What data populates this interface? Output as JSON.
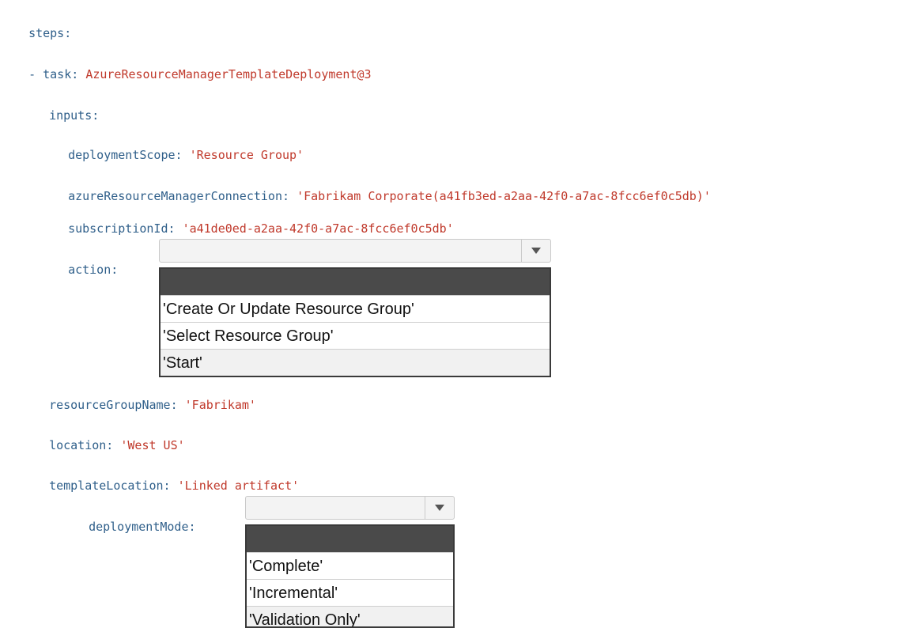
{
  "yaml": {
    "steps": "steps:",
    "task_dash": "- ",
    "task_key": "task:",
    "task_val": "AzureResourceManagerTemplateDeployment@3",
    "inputs": "inputs:",
    "deploymentScope_key": "deploymentScope:",
    "deploymentScope_val": "'Resource Group'",
    "connection_key": "azureResourceManagerConnection:",
    "connection_val": "'Fabrikam Corporate(a41fb3ed-a2aa-42f0-a7ac-8fcc6ef0c5db)'",
    "subscription_key": "subscriptionId:",
    "subscription_val": "'a41de0ed-a2aa-42f0-a7ac-8fcc6ef0c5db'",
    "action_key": "action:",
    "rg_key": "resourceGroupName:",
    "rg_val": "'Fabrikam'",
    "location_key": "location:",
    "location_val": "'West US'",
    "templateLocation_key": "templateLocation:",
    "templateLocation_val": "'Linked artifact'",
    "deploymentMode_key": "deploymentMode:"
  },
  "action_dropdown": {
    "selected": "",
    "options": [
      "'Create Or Update Resource Group'",
      "'Select Resource Group'",
      "'Start'"
    ]
  },
  "mode_dropdown": {
    "selected": "",
    "options": [
      "'Complete'",
      "'Incremental'",
      "'Validation Only'"
    ]
  },
  "icons": {
    "dropdown_arrow": "triangle-down-icon"
  }
}
